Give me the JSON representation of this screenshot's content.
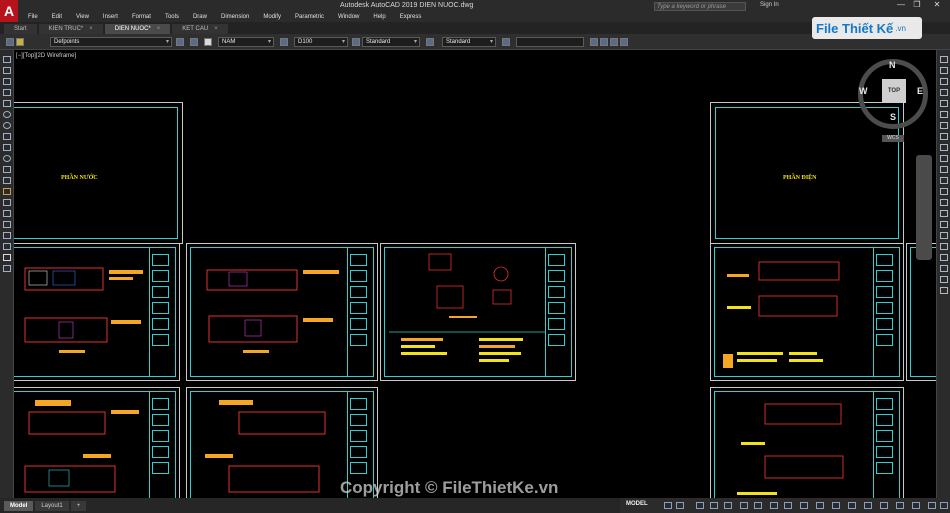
{
  "window": {
    "title": "Autodesk AutoCAD 2019   DIEN NUOC.dwg",
    "app_logo": "A",
    "search_placeholder": "Type a keyword or phrase",
    "signin": "Sign In",
    "minimize": "—",
    "restore": "❐",
    "close": "✕"
  },
  "menu": [
    "File",
    "Edit",
    "View",
    "Insert",
    "Format",
    "Tools",
    "Draw",
    "Dimension",
    "Modify",
    "Parametric",
    "Window",
    "Help",
    "Express"
  ],
  "doc_tabs": [
    {
      "label": "Start",
      "active": false
    },
    {
      "label": "KIEN TRUC*",
      "active": false
    },
    {
      "label": "DIEN NUOC*",
      "active": true
    },
    {
      "label": "KET CAU",
      "active": false
    }
  ],
  "toolbar": {
    "layer": "Defpoints",
    "color": "NAM",
    "linetype": "D100",
    "text_style": "Standard",
    "dim_style": "Standard"
  },
  "viewport_label": "[−][Top][2D Wireframe]",
  "viewcube": {
    "top": "TOP",
    "north": "N",
    "south": "S",
    "east": "E",
    "west": "W",
    "wcs": "WCS"
  },
  "sheets": {
    "water_title": "PHẦN NƯỚC",
    "electric_title": "PHẦN ĐIỆN"
  },
  "layout_tabs": [
    {
      "label": "Model",
      "active": true
    },
    {
      "label": "Layout1",
      "active": false
    },
    {
      "label": "+",
      "active": false
    }
  ],
  "status": {
    "model": "MODEL"
  },
  "watermark": {
    "logo_main": "File Thiết Kế",
    "logo_domain": ".vn",
    "copyright": "Copyright © FileThietKe.vn"
  },
  "colors": {
    "accent_red": "#b8121a",
    "cyan": "#2fd0d0",
    "yellow": "#f2e21a",
    "orange": "#f5a623"
  }
}
